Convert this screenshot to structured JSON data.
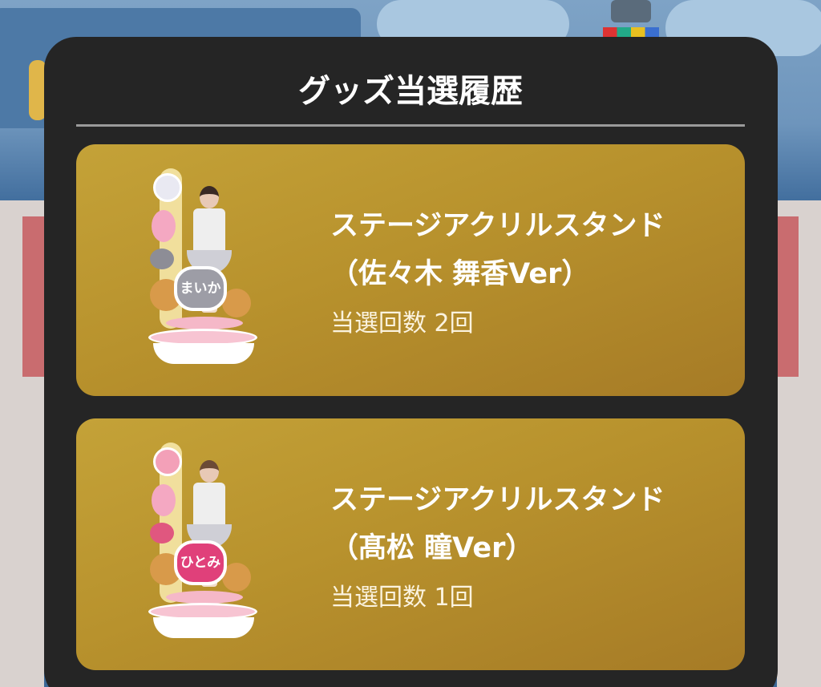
{
  "modal": {
    "title": "グッズ当選履歴"
  },
  "items": [
    {
      "name_line1": "ステージアクリルスタンド",
      "name_line2": "（佐々木 舞香Ver）",
      "count_text": "当選回数 2回",
      "nameplate": "まいか",
      "heart_color": "#9d9da6",
      "small_heart_color": "#8d8d96"
    },
    {
      "name_line1": "ステージアクリルスタンド",
      "name_line2": "（髙松 瞳Ver）",
      "count_text": "当選回数 1回",
      "nameplate": "ひとみ",
      "heart_color": "#e0407a",
      "small_heart_color": "#e0577f"
    }
  ],
  "colors": {
    "modal_bg": "#252525",
    "card_gold": "#b8922d",
    "text": "#ffffff"
  }
}
